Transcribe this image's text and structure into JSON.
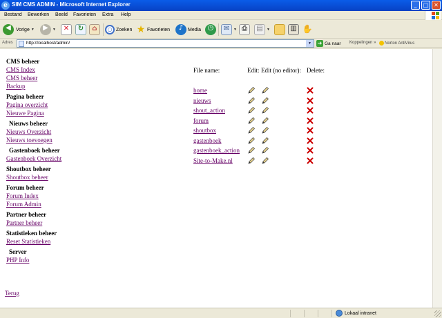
{
  "window": {
    "title": "SIM CMS ADMIN - Microsoft Internet Explorer",
    "buttons": {
      "minimize": "_",
      "maximize": "□",
      "close": "✕"
    }
  },
  "menu": [
    "Bestand",
    "Bewerken",
    "Beeld",
    "Favorieten",
    "Extra",
    "Help"
  ],
  "toolbar": {
    "back": "Vorige",
    "search": "Zoeken",
    "favorites": "Favorieten",
    "media": "Media"
  },
  "address": {
    "label": "Adres",
    "url": "http://localhost/admin/",
    "go": "Ga naar",
    "links": "Koppelingen",
    "links_chevron": "»",
    "norton": "Norton AntiVirus"
  },
  "sidebar": {
    "sections": [
      {
        "title": "CMS beheer",
        "links": [
          "CMS Index",
          "CMS beheer",
          "Backup"
        ]
      },
      {
        "title": "Pagina beheer",
        "links": [
          "Pagina overzicht",
          "Nieuwe Pagina"
        ]
      },
      {
        "title": "Nieuws beheer",
        "links": [
          "Nieuws Overzicht",
          "Nieuws toevoegen"
        ]
      },
      {
        "title": "Gastenboek beheer",
        "links": [
          "Gastenboek Overzicht"
        ]
      },
      {
        "title": "Shoutbox beheer",
        "links": [
          "Shoutbox beheer"
        ]
      },
      {
        "title": "Forum beheer",
        "links": [
          "Forum Index",
          "Forum Admin"
        ]
      },
      {
        "title": "Partner beheer",
        "links": [
          "Partner beheer"
        ]
      },
      {
        "title": "Statistieken beheer",
        "links": [
          "Reset Statistieken"
        ]
      },
      {
        "title": "Server",
        "links": [
          "PHP Info"
        ]
      }
    ],
    "back_link": "Terug"
  },
  "pages_table": {
    "headers": {
      "file_name": "File name:",
      "edit": "Edit:",
      "edit_no_editor": "Edit (no editor):",
      "delete": "Delete:"
    },
    "rows": [
      "home",
      "nieuws",
      "shout_action",
      "forum",
      "shoutbox",
      "gastenboek",
      "gastenboek_action",
      "Site-to-Make.nl"
    ]
  },
  "status": {
    "zone": "Lokaal intranet"
  },
  "colors": {
    "titlebar": "#0842c5",
    "link_visited": "#660066",
    "delete_x": "#cc0000",
    "chrome": "#ece9d8"
  }
}
